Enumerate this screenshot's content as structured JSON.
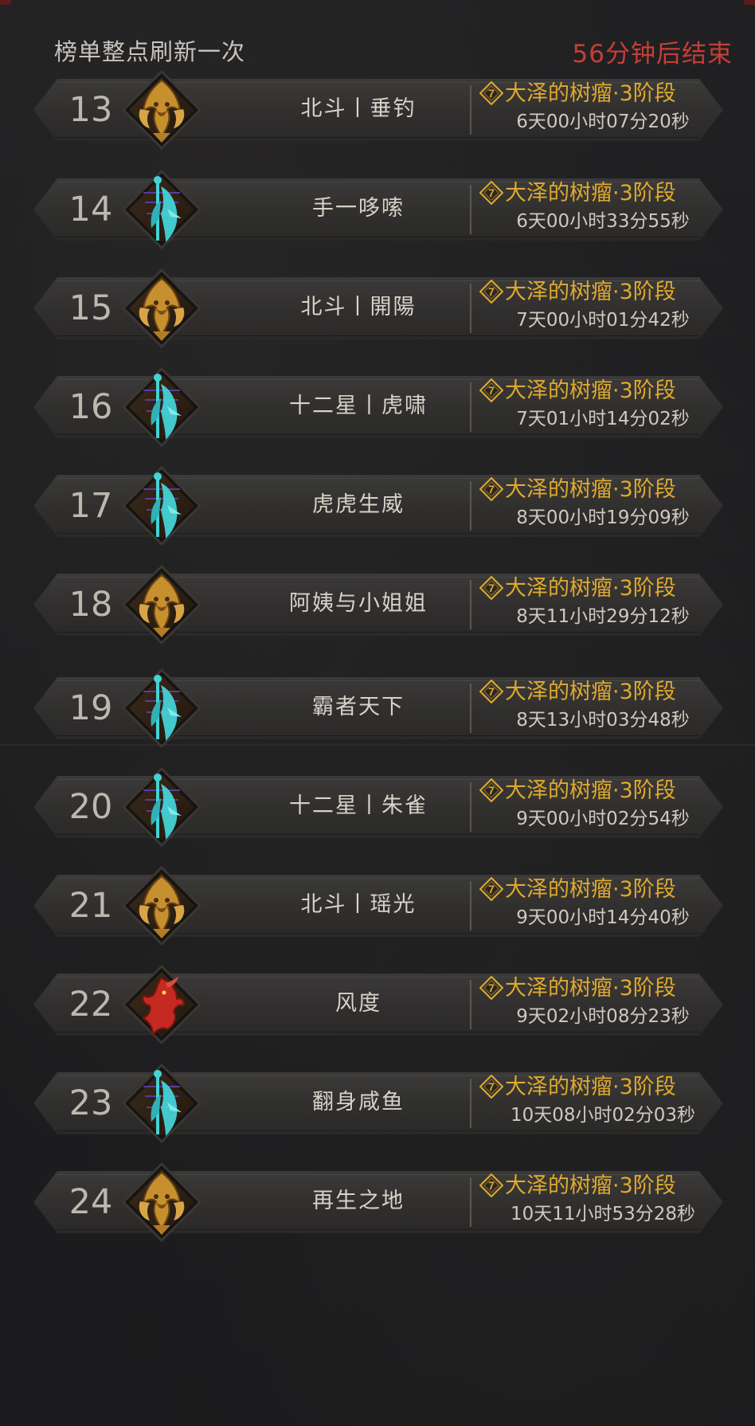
{
  "header": {
    "refresh_note": "榜单整点刷新一次",
    "countdown": "56分钟后结束"
  },
  "colors": {
    "rank_text": "#bdb7ae",
    "dungeon_gold": "#e0a92c",
    "countdown_red": "#c43f36",
    "emblem_gold": "#c7902f",
    "emblem_cyan": "#45d2d6",
    "emblem_red": "#c42a22"
  },
  "rows": [
    {
      "rank": "13",
      "emblem": "lion-gold-emblem-icon",
      "name": "北斗丨垂钓",
      "level": "7",
      "dungeon": "大泽的树瘤·3阶段",
      "time": "6天00小时07分20秒"
    },
    {
      "rank": "14",
      "emblem": "specter-cyan-emblem-icon",
      "name": "手一哆嗦",
      "level": "7",
      "dungeon": "大泽的树瘤·3阶段",
      "time": "6天00小时33分55秒"
    },
    {
      "rank": "15",
      "emblem": "lion-gold-emblem-icon",
      "name": "北斗丨開陽",
      "level": "7",
      "dungeon": "大泽的树瘤·3阶段",
      "time": "7天00小时01分42秒"
    },
    {
      "rank": "16",
      "emblem": "specter-cyan-emblem-icon",
      "name": "十二星丨虎啸",
      "level": "7",
      "dungeon": "大泽的树瘤·3阶段",
      "time": "7天01小时14分02秒"
    },
    {
      "rank": "17",
      "emblem": "specter-cyan-emblem-icon",
      "name": "虎虎生威",
      "level": "7",
      "dungeon": "大泽的树瘤·3阶段",
      "time": "8天00小时19分09秒"
    },
    {
      "rank": "18",
      "emblem": "lion-gold-emblem-icon",
      "name": "阿姨与小姐姐",
      "level": "7",
      "dungeon": "大泽的树瘤·3阶段",
      "time": "8天11小时29分12秒"
    },
    {
      "rank": "19",
      "emblem": "specter-cyan-emblem-icon",
      "name": "霸者天下",
      "level": "7",
      "dungeon": "大泽的树瘤·3阶段",
      "time": "8天13小时03分48秒"
    },
    {
      "rank": "20",
      "emblem": "specter-cyan-emblem-icon",
      "name": "十二星丨朱雀",
      "level": "7",
      "dungeon": "大泽的树瘤·3阶段",
      "time": "9天00小时02分54秒"
    },
    {
      "rank": "21",
      "emblem": "lion-gold-emblem-icon",
      "name": "北斗丨瑶光",
      "level": "7",
      "dungeon": "大泽的树瘤·3阶段",
      "time": "9天00小时14分40秒"
    },
    {
      "rank": "22",
      "emblem": "dragon-red-emblem-icon",
      "name": "风度",
      "level": "7",
      "dungeon": "大泽的树瘤·3阶段",
      "time": "9天02小时08分23秒"
    },
    {
      "rank": "23",
      "emblem": "specter-cyan-emblem-icon",
      "name": "翻身咸鱼",
      "level": "7",
      "dungeon": "大泽的树瘤·3阶段",
      "time": "10天08小时02分03秒"
    },
    {
      "rank": "24",
      "emblem": "lion-gold-emblem-icon",
      "name": "再生之地",
      "level": "7",
      "dungeon": "大泽的树瘤·3阶段",
      "time": "10天11小时53分28秒"
    }
  ]
}
